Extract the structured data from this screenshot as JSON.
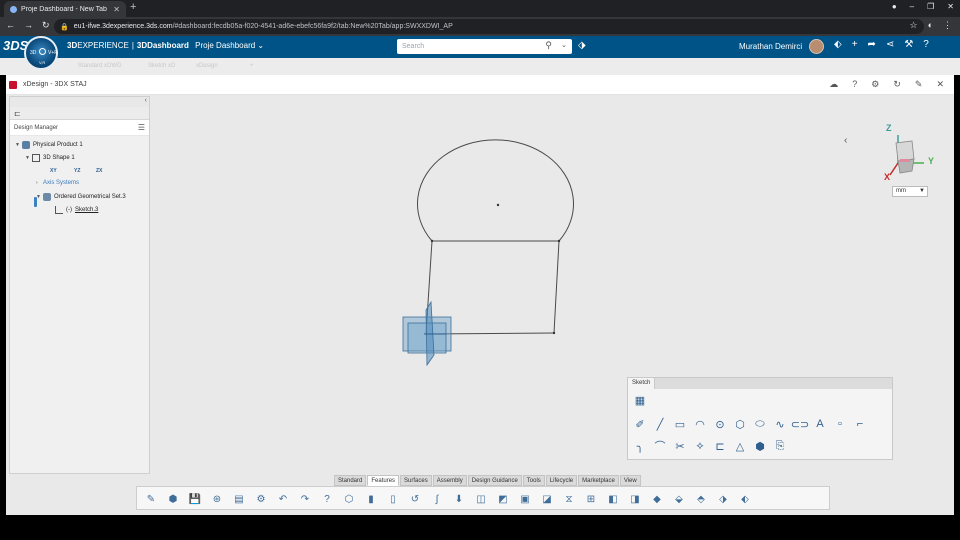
{
  "browser": {
    "tab_title": "Proje Dashboard - New Tab",
    "tab_close": "✕",
    "new_tab": "+",
    "url_host": "eu1-ifwe.3dexperience.3ds.com",
    "url_path": "/#dashboard:fecdb05a-f020-4541-ad6e-ebefc56fa9f2/tab:New%20Tab/app:SWXXDWI_AP",
    "minimize": "–",
    "maximize": "❐",
    "close": "✕",
    "back": "←",
    "forward": "→",
    "reload": "↻",
    "star": "☆"
  },
  "topbar": {
    "logo": "3DS",
    "brand_bold": "3D",
    "brand_exp": "EXPERIENCE",
    "brand_sep": "|",
    "brand_app": "3DDashboard",
    "dashboard_name": "Proje Dashboard",
    "dashboard_caret": "⌄",
    "search_placeholder": "Search",
    "user_name": "Murathan Demirci",
    "compass_left": "3D",
    "compass_right": "V+R",
    "compass_bottom": "V,R"
  },
  "dashboard_tabs": [
    "Standard xDWG",
    "Sketch xD",
    "xDesign",
    "+"
  ],
  "app": {
    "title": "xDesign - 3DX STAJ"
  },
  "tree": {
    "header": "Design Manager",
    "nodes": [
      {
        "label": "Physical Product 1"
      },
      {
        "label": "3D Shape 1"
      },
      {
        "label": "Axis Systems"
      },
      {
        "label": "Ordered Geometrical Set.3"
      },
      {
        "label": "Sketch.3"
      }
    ],
    "planes": [
      "XY",
      "YZ",
      "ZX"
    ],
    "sketch_prefix": "(-)"
  },
  "navcube": {
    "x_label": "X",
    "y_label": "Y",
    "z_label": "Z",
    "unit": "mm"
  },
  "sketch_panel": {
    "tab": "Sketch"
  },
  "action_tabs": [
    "Standard",
    "Features",
    "Surfaces",
    "Assembly",
    "Design Guidance",
    "Tools",
    "Lifecycle",
    "Marketplace",
    "View"
  ],
  "active_action_tab": "Features",
  "colors": {
    "topbar": "#005386",
    "viewport": "#e9e9e9",
    "sketch_line": "#4a4a4a",
    "plane_fill": "#6aa0c8",
    "accent_blue": "#3b82c4"
  }
}
